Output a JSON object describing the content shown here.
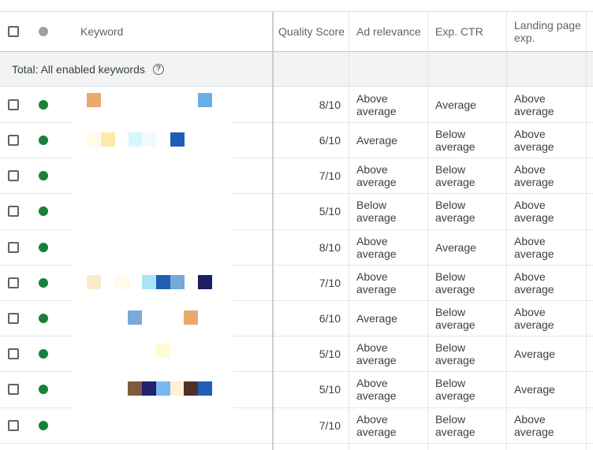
{
  "colors": {
    "status_enabled": "#188038",
    "header_status": "#9aa0a6",
    "grid": "#e3e5e8"
  },
  "header": {
    "keyword": "Keyword",
    "quality_score": "Quality Score",
    "ad_relevance": "Ad relevance",
    "exp_ctr": "Exp. CTR",
    "landing_page_exp": "Landing page exp."
  },
  "total_row": {
    "label": "Total: All enabled keywords",
    "help_icon": "help-circle-icon"
  },
  "rows": [
    {
      "quality_score": "8/10",
      "ad_relevance": "Above average",
      "exp_ctr": "Average",
      "landing_page_exp": "Above average",
      "redacted_colors": [
        "#e8a96d",
        "#6aaee8"
      ]
    },
    {
      "quality_score": "6/10",
      "ad_relevance": "Average",
      "exp_ctr": "Below average",
      "landing_page_exp": "Above average",
      "redacted_colors": [
        "#fffbe6",
        "#fde9a8",
        "#d6f6ff",
        "#f0fbff",
        "#1f5fb3"
      ]
    },
    {
      "quality_score": "7/10",
      "ad_relevance": "Above average",
      "exp_ctr": "Below average",
      "landing_page_exp": "Above average",
      "redacted_colors": []
    },
    {
      "quality_score": "5/10",
      "ad_relevance": "Below average",
      "exp_ctr": "Below average",
      "landing_page_exp": "Above average",
      "redacted_colors": []
    },
    {
      "quality_score": "8/10",
      "ad_relevance": "Above average",
      "exp_ctr": "Average",
      "landing_page_exp": "Above average",
      "redacted_colors": []
    },
    {
      "quality_score": "7/10",
      "ad_relevance": "Above average",
      "exp_ctr": "Below average",
      "landing_page_exp": "Above average",
      "redacted_colors": [
        "#fdebc8",
        "#fffbe9",
        "#a9e4fb",
        "#1f5fb3",
        "#77a7d8",
        "#1d1f63"
      ]
    },
    {
      "quality_score": "6/10",
      "ad_relevance": "Average",
      "exp_ctr": "Below average",
      "landing_page_exp": "Above average",
      "redacted_colors": [
        "#7aa9db",
        "#e9a86a"
      ]
    },
    {
      "quality_score": "5/10",
      "ad_relevance": "Above average",
      "exp_ctr": "Below average",
      "landing_page_exp": "Average",
      "redacted_colors": [
        "#fffbd3"
      ]
    },
    {
      "quality_score": "5/10",
      "ad_relevance": "Above average",
      "exp_ctr": "Below average",
      "landing_page_exp": "Average",
      "redacted_colors": [
        "#7d5b3f",
        "#23226f",
        "#79b7f0",
        "#fff1d4",
        "#4f2f28",
        "#1f5fb3"
      ]
    },
    {
      "quality_score": "7/10",
      "ad_relevance": "Above average",
      "exp_ctr": "Below average",
      "landing_page_exp": "Above average",
      "redacted_colors": []
    }
  ]
}
